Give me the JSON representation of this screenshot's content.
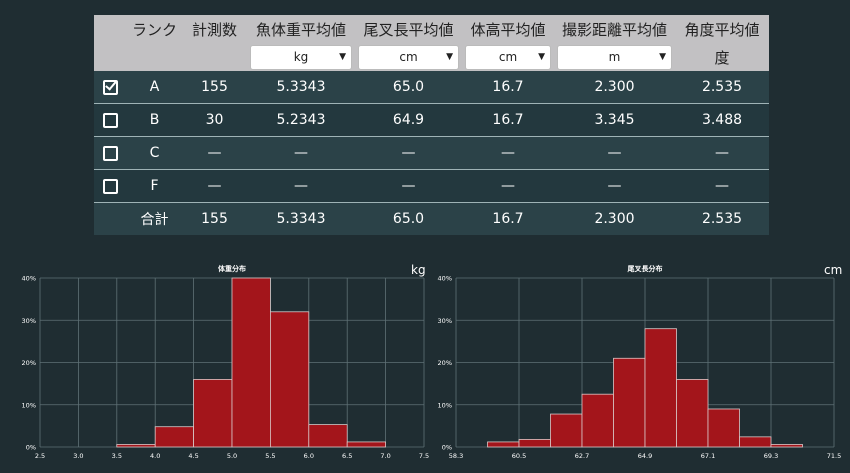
{
  "table": {
    "headers": [
      "",
      "ランク",
      "計測数",
      "魚体重平均値",
      "尾叉長平均値",
      "体高平均値",
      "撮影距離平均値",
      "角度平均値"
    ],
    "units": [
      "kg",
      "cm",
      "cm",
      "m"
    ],
    "angle_unit": "度",
    "rows": [
      {
        "checked": true,
        "rank": "A",
        "count": "155",
        "weight": "5.3343",
        "length": "65.0",
        "height": "16.7",
        "distance": "2.300",
        "angle": "2.535"
      },
      {
        "checked": false,
        "rank": "B",
        "count": "30",
        "weight": "5.2343",
        "length": "64.9",
        "height": "16.7",
        "distance": "3.345",
        "angle": "3.488"
      },
      {
        "checked": false,
        "rank": "C",
        "count": "—",
        "weight": "—",
        "length": "—",
        "height": "—",
        "distance": "—",
        "angle": "—"
      },
      {
        "checked": false,
        "rank": "F",
        "count": "—",
        "weight": "—",
        "length": "—",
        "height": "—",
        "distance": "—",
        "angle": "—"
      }
    ],
    "total": {
      "label": "合計",
      "count": "155",
      "weight": "5.3343",
      "length": "65.0",
      "height": "16.7",
      "distance": "2.300",
      "angle": "2.535"
    }
  },
  "colors": {
    "bar": "#a3151b",
    "background": "#1f2d32",
    "header": "#c2c1c3"
  },
  "chart_data": [
    {
      "type": "bar",
      "title": "体重分布",
      "unit": "kg",
      "ylim": [
        0,
        40
      ],
      "yticks": [
        "0%",
        "10%",
        "20%",
        "30%",
        "40%"
      ],
      "xticks": [
        "2.5",
        "3.0",
        "3.5",
        "4.0",
        "4.5",
        "5.0",
        "5.5",
        "6.0",
        "6.5",
        "7.0",
        "7.5"
      ],
      "values": [
        0,
        0,
        0.6,
        4.8,
        16,
        40,
        32,
        5.3,
        1.2,
        0
      ],
      "grid": true
    },
    {
      "type": "bar",
      "title": "尾叉長分布",
      "unit": "cm",
      "ylim": [
        0,
        40
      ],
      "yticks": [
        "0%",
        "10%",
        "20%",
        "30%",
        "40%"
      ],
      "xticks": [
        "58.3",
        "60.5",
        "62.7",
        "64.9",
        "67.1",
        "69.3",
        "71.5"
      ],
      "values": [
        0,
        1.2,
        1.8,
        7.8,
        12.5,
        21,
        28,
        16,
        9,
        2.4,
        0.6,
        0
      ],
      "grid": true
    }
  ]
}
